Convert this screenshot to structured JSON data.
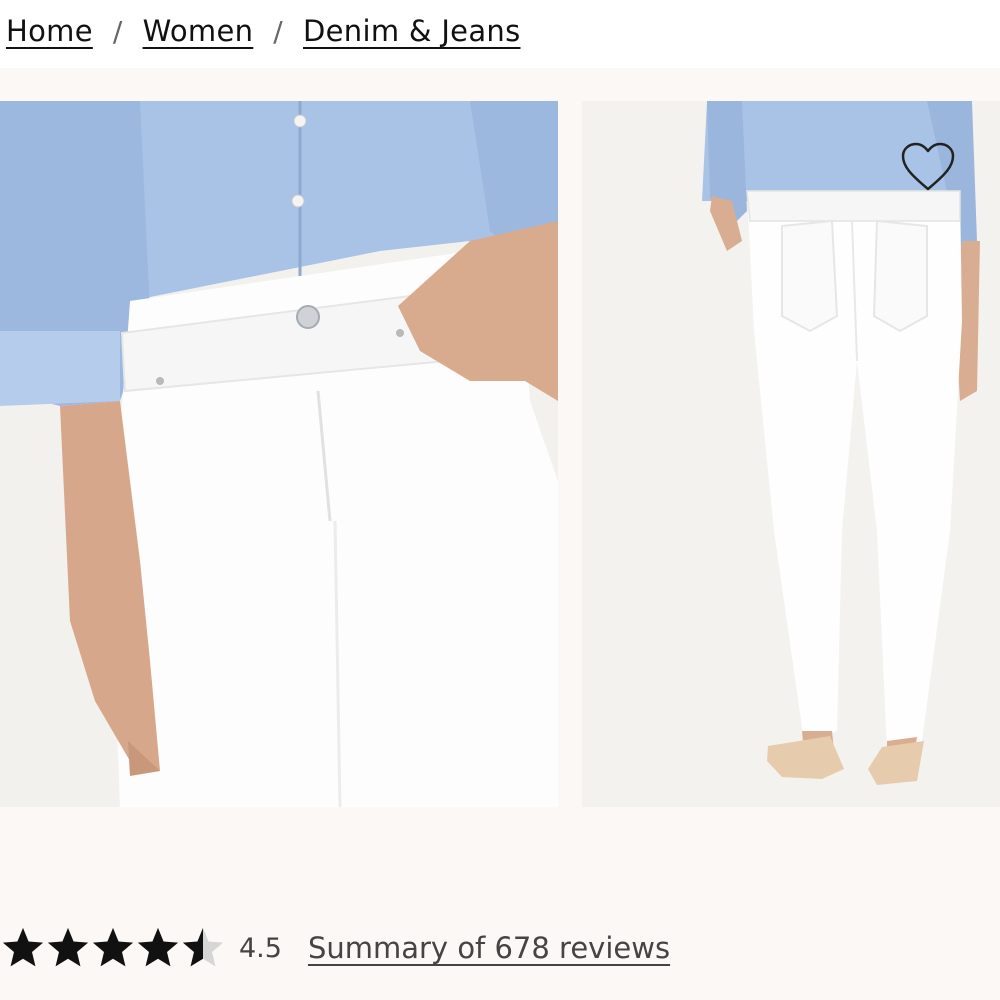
{
  "breadcrumb": {
    "items": [
      "Home",
      "Women",
      "Denim & Jeans"
    ],
    "separator": "/"
  },
  "gallery": {
    "images": [
      {
        "view": "front close-up",
        "subject": "white skinny jeans with light blue shirt"
      },
      {
        "view": "back full-length",
        "subject": "white skinny jeans with light blue shirt and flats"
      }
    ],
    "favorite_icon": "heart-icon"
  },
  "rating": {
    "stars": 4.5,
    "value_text": "4.5",
    "reviews_link": "Summary of 678 reviews"
  },
  "colors": {
    "background": "#fbf8f5",
    "text": "#111111",
    "muted_text": "#444444",
    "shirt_blue": "#a9c3e6",
    "denim_white": "#fdfdfd"
  }
}
